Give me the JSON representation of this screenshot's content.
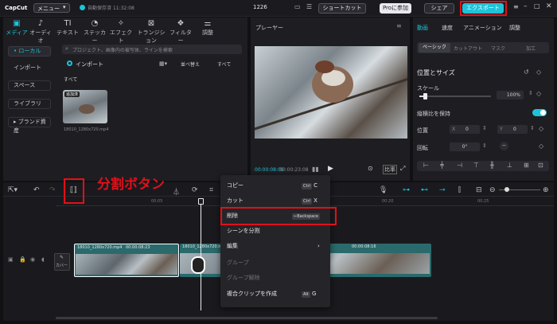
{
  "topbar": {
    "logo": "CapCut",
    "menu_label": "メニュー",
    "autosave": "自動保存済 11:32:08",
    "project_number": "1226",
    "shortcut_label": "ショートカット",
    "pro_label": "Proに参加",
    "share_label": "シェア",
    "export_label": "エクスポート"
  },
  "toolbar": [
    {
      "label": "メディア",
      "icon": "▣"
    },
    {
      "label": "オーディオ",
      "icon": "♪"
    },
    {
      "label": "テキスト",
      "icon": "TI"
    },
    {
      "label": "ステッカー",
      "icon": "◔"
    },
    {
      "label": "エフェクト",
      "icon": "✧"
    },
    {
      "label": "トランジション",
      "icon": "⊠"
    },
    {
      "label": "フィルター",
      "icon": "❖"
    },
    {
      "label": "調整",
      "icon": "⚌"
    }
  ],
  "sidebar": {
    "items": [
      "• ローカル",
      "インポート",
      "スペース",
      "ライブラリ",
      "▸ ブランド資産"
    ]
  },
  "media": {
    "search_placeholder": "プロジェクト、画像内の被写体、ラインを検索",
    "import_label": "インポート",
    "sort_label": "並べ替え",
    "filter_label": "すべて",
    "all_label": "すべて",
    "added_badge": "追加済",
    "thumb_name": "18010_1280x720.mp4"
  },
  "player": {
    "title": "プレーヤー",
    "current_time": "00:00:08:09",
    "total_time": "00:00:23:08",
    "aspect_label": "比率"
  },
  "right_panel": {
    "tabs": [
      "動画",
      "速度",
      "アニメーション",
      "調整"
    ],
    "subtabs": [
      "ベーシック",
      "カットアウト",
      "マスク",
      "加工"
    ],
    "section_title": "位置とサイズ",
    "scale_label": "スケール",
    "scale_value": "100%",
    "scale_fraction": 0.08,
    "keep_ratio_label": "縦横比を保持",
    "position_label": "位置",
    "position_x": "0",
    "position_y": "0",
    "rotation_label": "回転",
    "rotation_value": "0°"
  },
  "annotation": {
    "text": "分割ボタン"
  },
  "timeline": {
    "ticks": [
      "00:05",
      "00:20",
      "00:25"
    ],
    "cover_label": "カバー",
    "clip1_label": "18010_1280x720.mp4",
    "clip1_time": "00:00:08:23",
    "clip2_label": "18010_1280x720.mp4",
    "clip3_time": "00:00:08:16"
  },
  "context_menu": {
    "items": [
      {
        "label": "コピー",
        "shortcut_mod": "Ctrl",
        "shortcut_key": "C"
      },
      {
        "label": "カット",
        "shortcut_mod": "Ctrl",
        "shortcut_key": "X"
      },
      {
        "label": "削除",
        "shortcut_mod": "←Backspace",
        "shortcut_key": ""
      },
      {
        "label": "シーンを分割",
        "shortcut_mod": "",
        "shortcut_key": ""
      },
      {
        "label": "編集",
        "shortcut_mod": "",
        "shortcut_key": "›"
      },
      {
        "label": "グループ",
        "shortcut_mod": "",
        "shortcut_key": ""
      },
      {
        "label": "グループ解除",
        "shortcut_mod": "",
        "shortcut_key": ""
      },
      {
        "label": "複合クリップを作成",
        "shortcut_mod": "Alt",
        "shortcut_key": "G"
      }
    ]
  },
  "colors": {
    "accent": "#1ec3d8",
    "highlight": "#e0101a",
    "clip": "#2a6a6c"
  }
}
